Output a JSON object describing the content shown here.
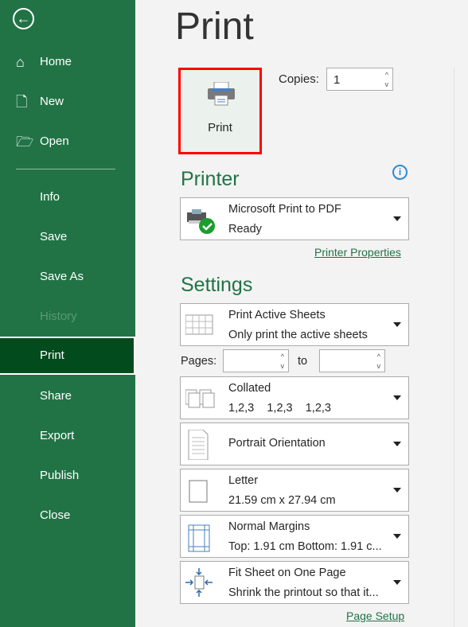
{
  "sidebar": {
    "items": [
      {
        "label": "Home",
        "icon": "home-icon"
      },
      {
        "label": "New",
        "icon": "new-document-icon"
      },
      {
        "label": "Open",
        "icon": "folder-open-icon"
      },
      {
        "label": "Info"
      },
      {
        "label": "Save"
      },
      {
        "label": "Save As"
      },
      {
        "label": "History",
        "disabled": true
      },
      {
        "label": "Print",
        "selected": true
      },
      {
        "label": "Share"
      },
      {
        "label": "Export"
      },
      {
        "label": "Publish"
      },
      {
        "label": "Close"
      }
    ]
  },
  "main": {
    "title": "Print",
    "print_button": "Print",
    "copies_label": "Copies:",
    "copies_value": "1",
    "printer_heading": "Printer",
    "printer_name": "Microsoft Print to PDF",
    "printer_status": "Ready",
    "printer_properties": "Printer Properties",
    "settings_heading": "Settings",
    "what": {
      "title": "Print Active Sheets",
      "sub": "Only print the active sheets"
    },
    "pages_label": "Pages:",
    "pages_from": "",
    "to_label": "to",
    "pages_to": "",
    "collate": {
      "title": "Collated",
      "sub": "1,2,3    1,2,3    1,2,3"
    },
    "orientation": {
      "title": "Portrait Orientation"
    },
    "paper": {
      "title": "Letter",
      "sub": "21.59 cm x 27.94 cm"
    },
    "margins": {
      "title": "Normal Margins",
      "sub": "Top: 1.91 cm Bottom: 1.91 c..."
    },
    "scaling": {
      "title": "Fit Sheet on One Page",
      "sub": "Shrink the printout so that it..."
    },
    "page_setup": "Page Setup"
  },
  "colors": {
    "accent": "#217346",
    "selected": "#024b1c",
    "highlight": "#ff0000"
  }
}
